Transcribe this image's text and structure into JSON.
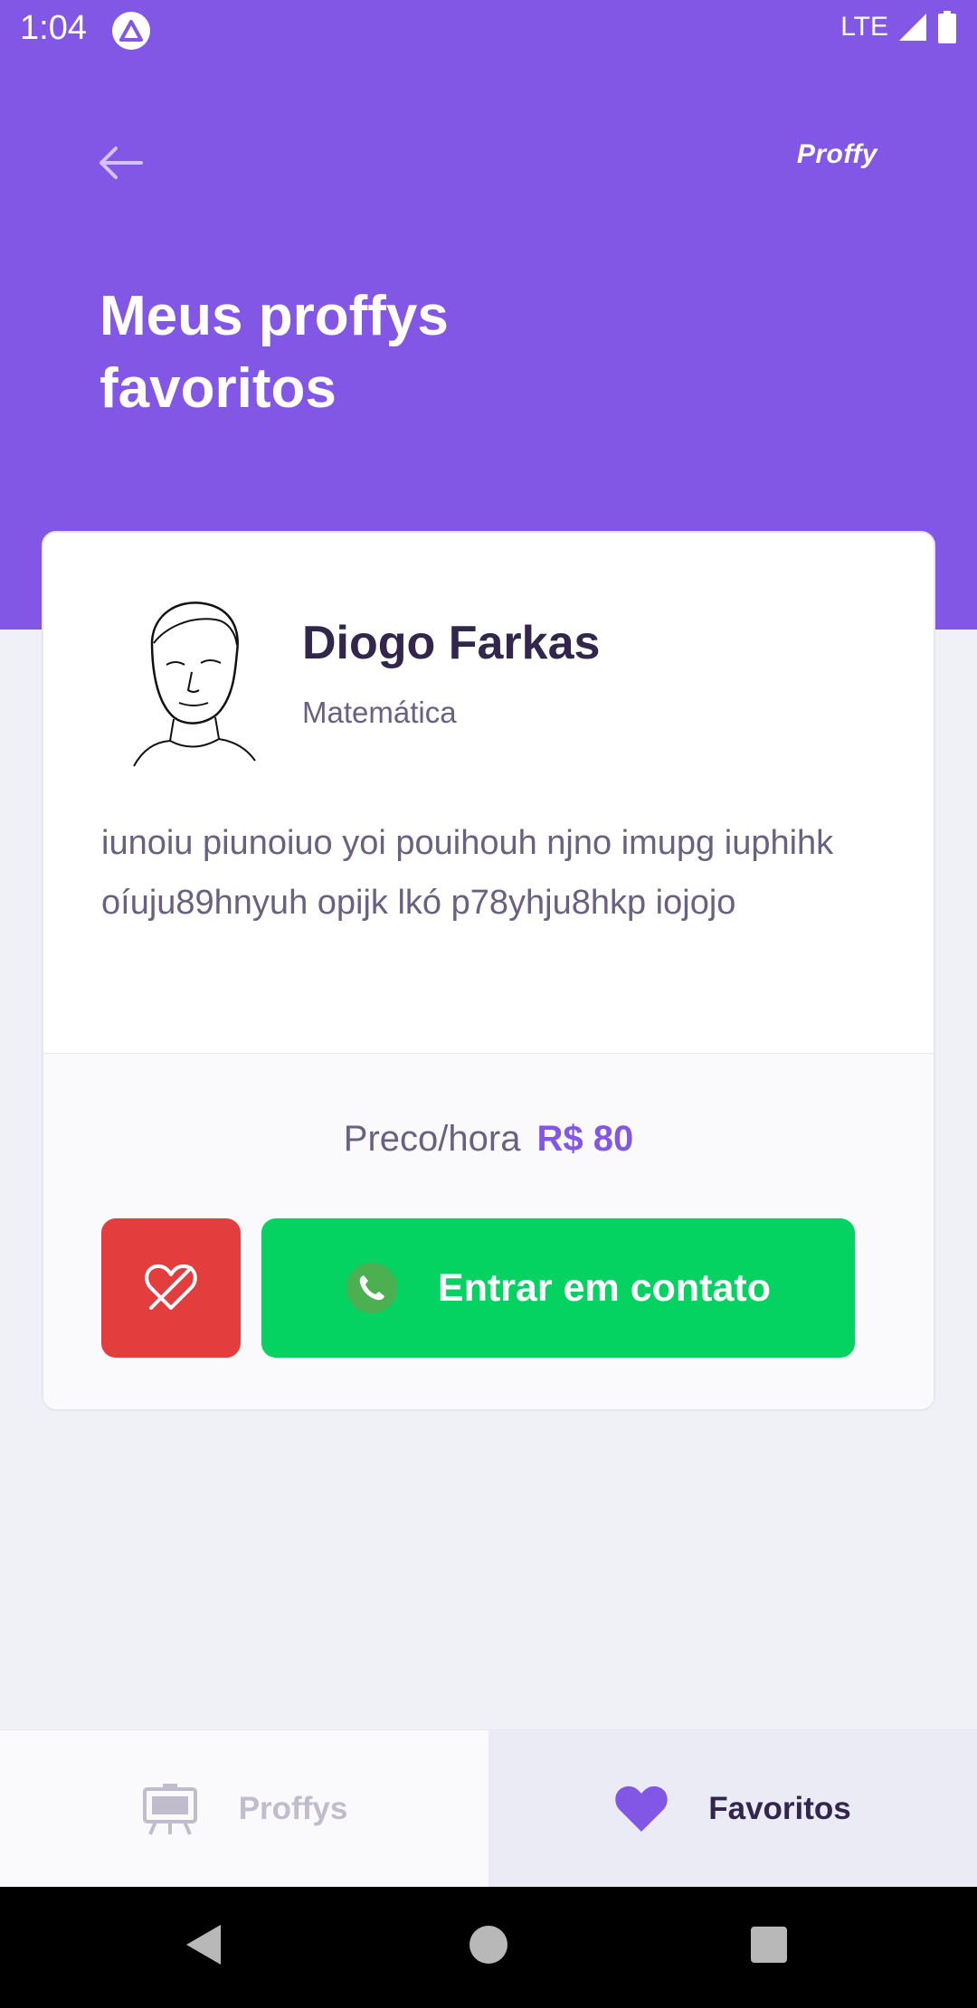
{
  "status_bar": {
    "time": "1:04",
    "network": "LTE",
    "icons": [
      "expo-app-icon",
      "signal-icon",
      "battery-icon"
    ]
  },
  "header": {
    "back_icon": "arrow-left-icon",
    "brand": "Proffy",
    "title": "Meus proffys favoritos"
  },
  "teacher_card": {
    "name": "Diogo Farkas",
    "subject": "Matemática",
    "bio": "iunoiu piunoiuo yoi pouihouh njno imupg iuphihk oíuju89hnyuh opijk lkó p78yhju8hkp iojojo",
    "price_label": "Preco/hora",
    "price_value": "R$ 80",
    "unfavorite_icon": "heart-outline-icon",
    "contact_label": "Entrar em contato",
    "contact_icon": "whatsapp-icon"
  },
  "tabs": [
    {
      "label": "Proffys",
      "icon": "easel-icon",
      "active": false
    },
    {
      "label": "Favoritos",
      "icon": "heart-icon",
      "active": true
    }
  ],
  "nav_bar": {
    "buttons": [
      "back-triangle-icon",
      "home-circle-icon",
      "recents-square-icon"
    ]
  },
  "colors": {
    "primary": "#8257E5",
    "danger": "#E33D3D",
    "success": "#04D361",
    "title_text": "#32264D",
    "body_text": "#6A6180",
    "background": "#F0F0F7"
  }
}
